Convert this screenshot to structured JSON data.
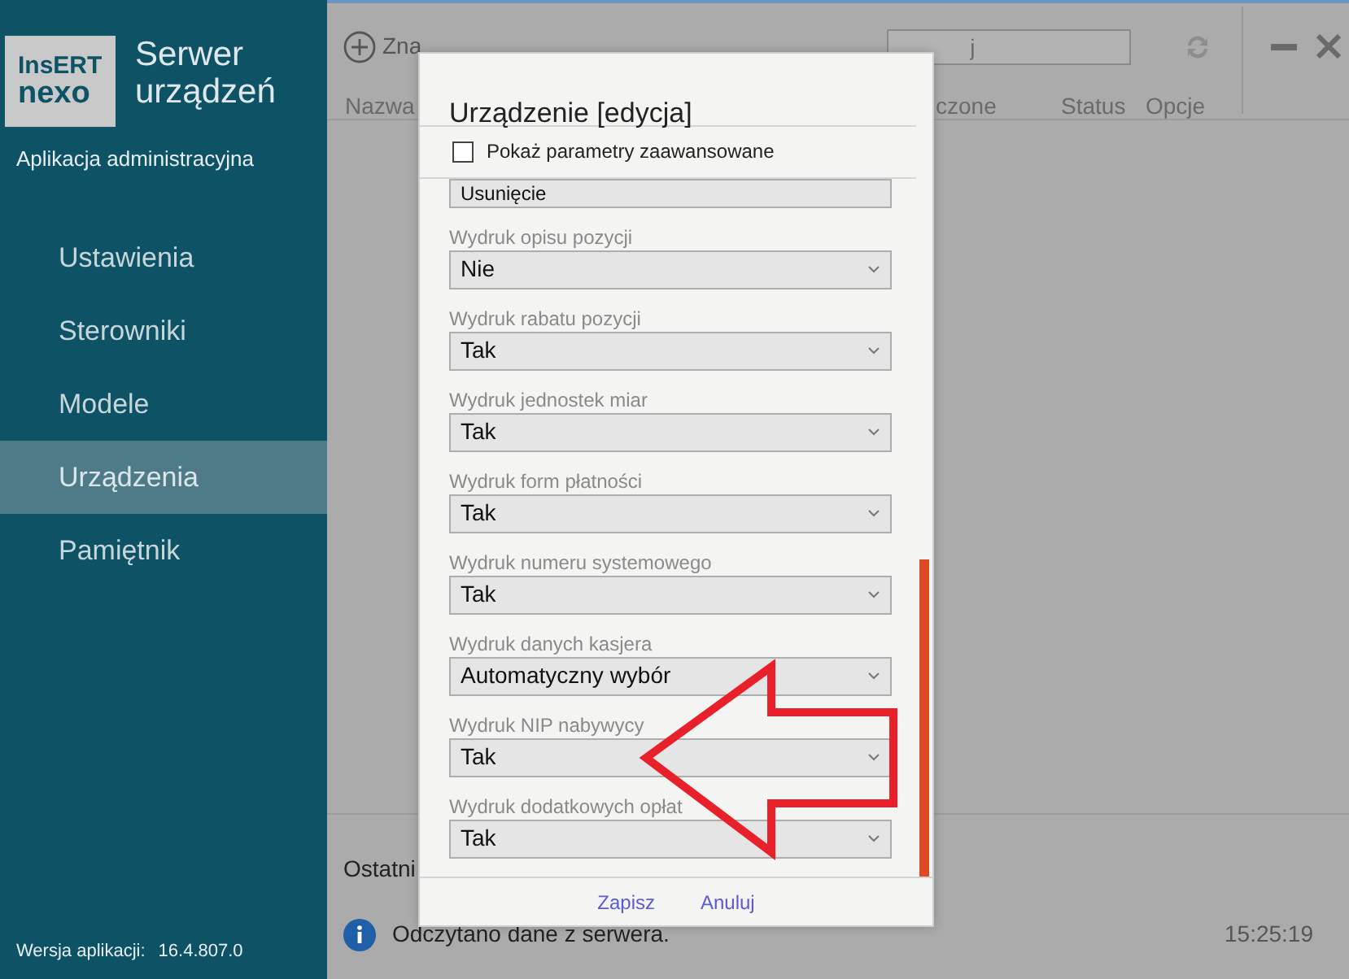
{
  "sidebar": {
    "logo": [
      "InsERT",
      "nexo"
    ],
    "app_title": [
      "Serwer",
      "urządzeń"
    ],
    "subtitle": "Aplikacja administracyjna",
    "items": [
      {
        "label": "Ustawienia",
        "selected": false
      },
      {
        "label": "Sterowniki",
        "selected": false
      },
      {
        "label": "Modele",
        "selected": false
      },
      {
        "label": "Urządzenia",
        "selected": true
      },
      {
        "label": "Pamiętnik",
        "selected": false
      }
    ],
    "version_label": "Wersja aplikacji:",
    "version": "16.4.807.0"
  },
  "toolbar": {
    "add_button": "Zna",
    "search": {
      "placeholder": "j"
    }
  },
  "columns": [
    "Nazwa",
    "czone",
    "Status",
    "Opcje"
  ],
  "log": {
    "heading": "Ostatni",
    "message": "Odczytano dane z serwera.",
    "time": "15:25:19"
  },
  "dialog": {
    "title": "Urządzenie [edycja]",
    "advanced": {
      "label": "Pokaż parametry zaawansowane",
      "checked": false
    },
    "fields": [
      {
        "value": "Usunięcie"
      },
      {
        "label": "Wydruk opisu pozycji",
        "value": "Nie"
      },
      {
        "label": "Wydruk rabatu pozycji",
        "value": "Tak"
      },
      {
        "label": "Wydruk jednostek miar",
        "value": "Tak"
      },
      {
        "label": "Wydruk form płatności",
        "value": "Tak"
      },
      {
        "label": "Wydruk numeru systemowego",
        "value": "Tak"
      },
      {
        "label": "Wydruk danych kasjera",
        "value": "Automatyczny wybór"
      },
      {
        "label": "Wydruk NIP nabywycy",
        "value": "Tak"
      },
      {
        "label": "Wydruk dodatkowych opłat",
        "value": "Tak"
      }
    ],
    "buttons": [
      "Zapisz",
      "Anuluj"
    ]
  }
}
